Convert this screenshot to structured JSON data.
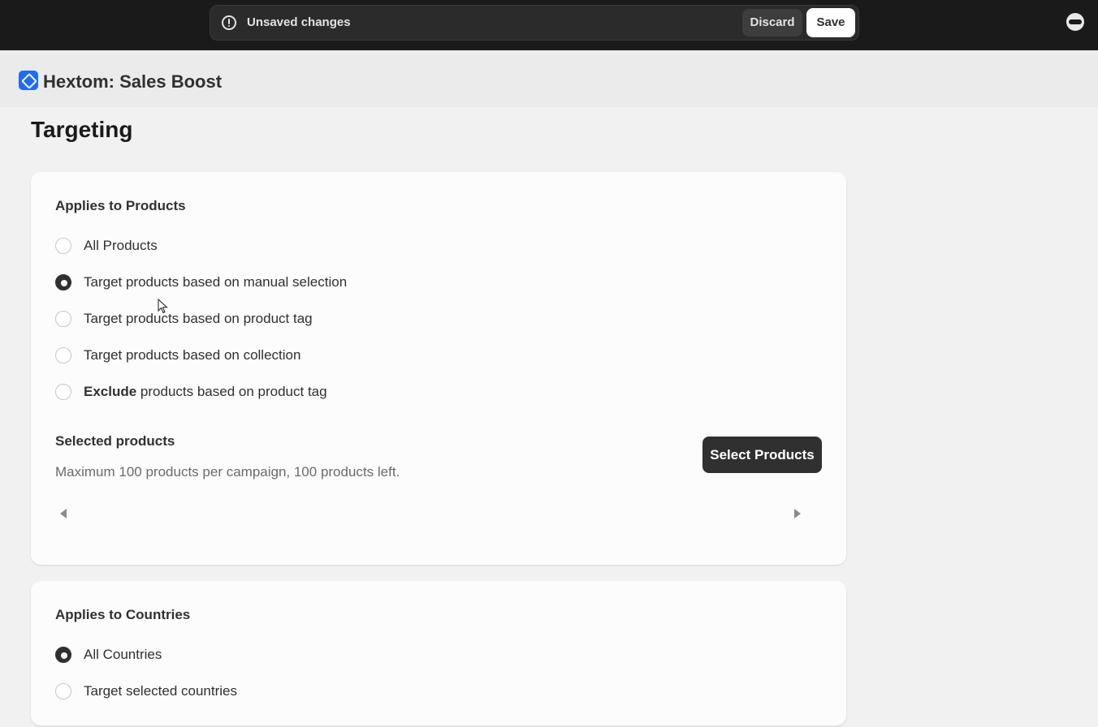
{
  "topbar": {
    "unsaved_text": "Unsaved changes",
    "discard_label": "Discard",
    "save_label": "Save",
    "profile_icon": "profile-icon"
  },
  "app": {
    "title": "Hextom: Sales Boost",
    "logo_icon": "tag-icon"
  },
  "page": {
    "title": "Targeting"
  },
  "products": {
    "heading": "Applies to Products",
    "options": [
      {
        "label": "All Products",
        "checked": false
      },
      {
        "label": "Target products based on manual selection",
        "checked": true
      },
      {
        "label": "Target products based on product tag",
        "checked": false
      },
      {
        "label": "Target products based on collection",
        "checked": false
      },
      {
        "label_bold": "Exclude",
        "label": " products based on product tag",
        "checked": false
      }
    ],
    "selected_heading": "Selected products",
    "selected_subtext": "Maximum 100 products per campaign, 100 products left.",
    "select_button": "Select Products"
  },
  "countries": {
    "heading": "Applies to Countries",
    "options": [
      {
        "label": "All Countries",
        "checked": true
      },
      {
        "label": "Target selected countries",
        "checked": false
      }
    ]
  },
  "colors": {
    "topbar_bg": "#1a1a1a",
    "brand_blue": "#1f6cf2",
    "primary_button": "#303030"
  }
}
